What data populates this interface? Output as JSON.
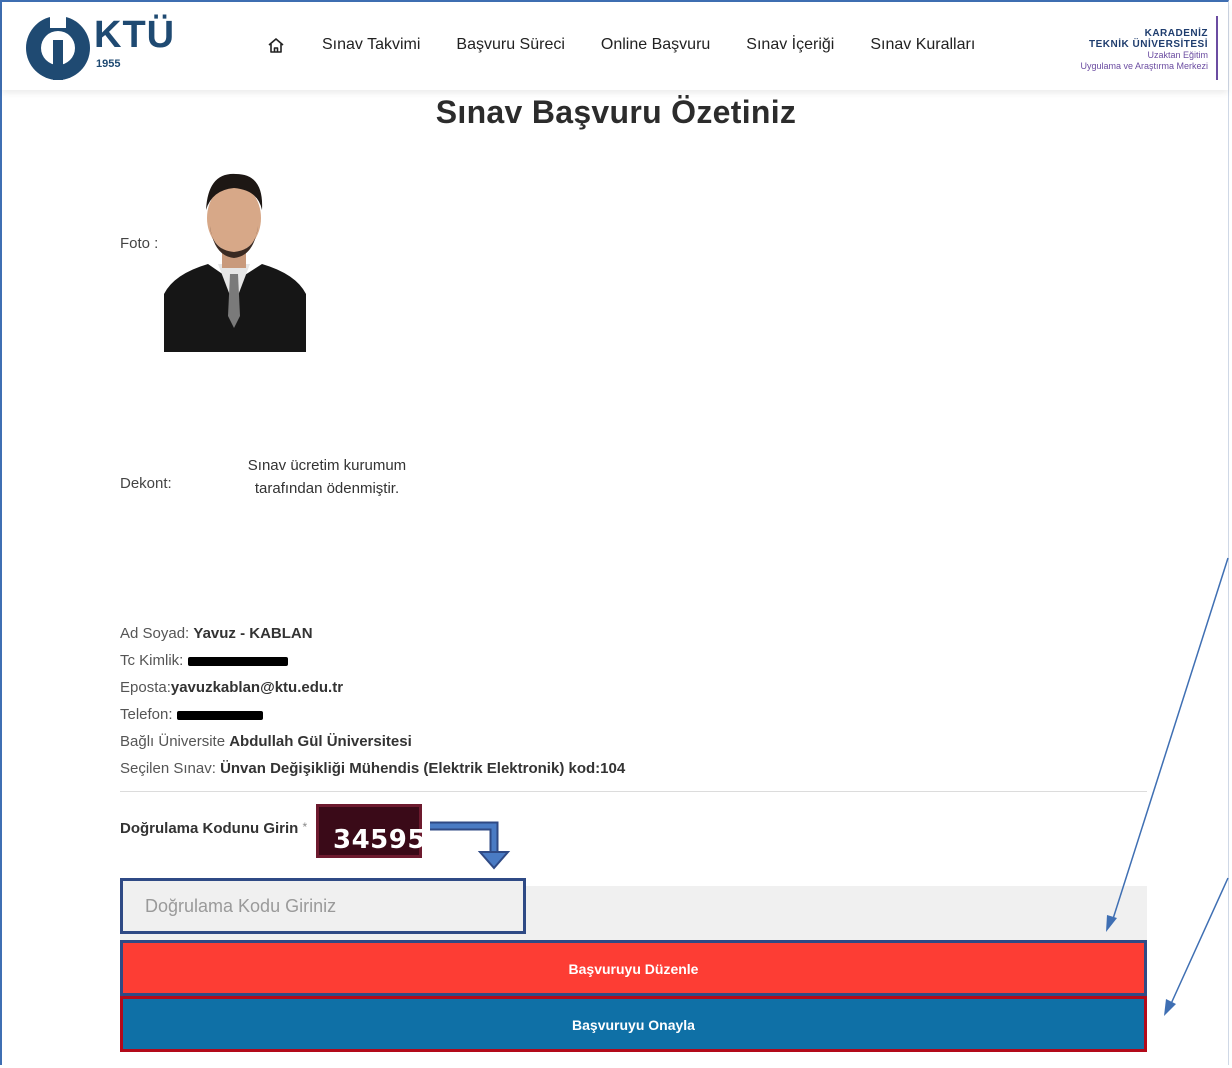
{
  "header": {
    "logo_text": "KTÜ",
    "logo_year": "1955",
    "nav": [
      {
        "label": "Sınav Takvimi"
      },
      {
        "label": "Başvuru Süreci"
      },
      {
        "label": "Online Başvuru"
      },
      {
        "label": "Sınav İçeriği"
      },
      {
        "label": "Sınav Kuralları"
      }
    ],
    "brand": {
      "line1": "KARADENİZ",
      "line2": "TEKNİK ÜNİVERSİTESİ",
      "line3": "Uzaktan Eğitim",
      "line4": "Uygulama ve Araştırma Merkezi"
    }
  },
  "page": {
    "title": "Sınav Başvuru Özetiniz",
    "photo_label": "Foto  :",
    "dekont_label": "Dekont:",
    "dekont_text": "Sınav ücretim kurumum tarafından ödenmiştir."
  },
  "info": {
    "name_label": "Ad Soyad: ",
    "name_value": "Yavuz - KABLAN",
    "tc_label": "Tc Kimlik: ",
    "email_label": "Eposta:",
    "email_value": "yavuzkablan@ktu.edu.tr",
    "phone_label": "Telefon: ",
    "uni_label": "Bağlı Üniversite ",
    "uni_value": "Abdullah Gül Üniversitesi",
    "exam_label": "Seçilen Sınav: ",
    "exam_value": "Ünvan Değişikliği Mühendis (Elektrik Elektronik) kod:104"
  },
  "verify": {
    "label": "Doğrulama Kodunu Girin",
    "required_mark": "*",
    "captcha": "34595",
    "input_placeholder": "Doğrulama Kodu Giriniz",
    "input_value": ""
  },
  "buttons": {
    "edit": "Başvuruyu Düzenle",
    "confirm": "Başvuruyu Onayla"
  },
  "colors": {
    "edit_bg": "#fd3d34",
    "confirm_bg": "#0f70a6",
    "annotation": "#3f6fb3"
  }
}
